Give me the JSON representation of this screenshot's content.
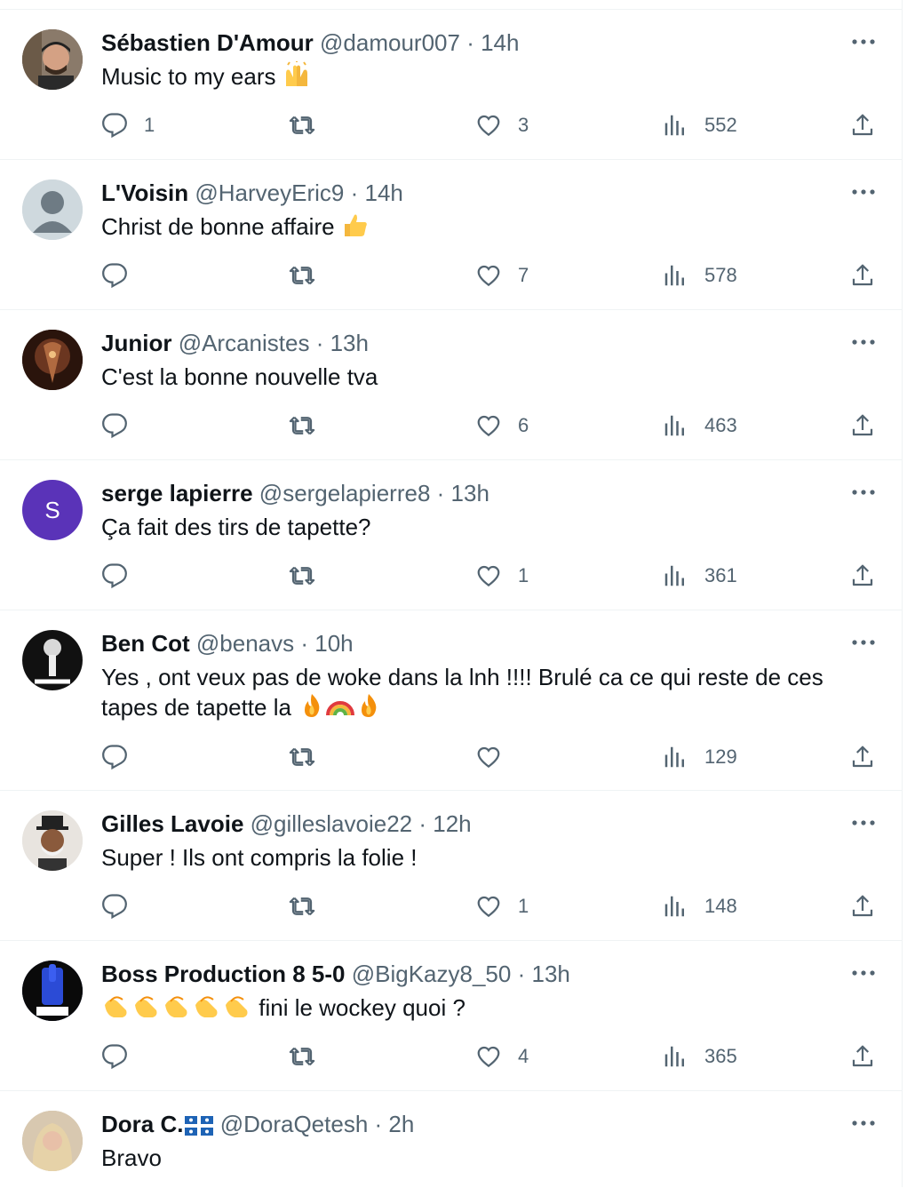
{
  "tweets": [
    {
      "name": "Sébastien D'Amour",
      "handle": "@damour007",
      "time": "14h",
      "text": "Music to my ears",
      "replies": "1",
      "retweets": "",
      "likes": "3",
      "views": "552",
      "avatar_color": "#5b4a3a"
    },
    {
      "name": "L'Voisin",
      "handle": "@HarveyEric9",
      "time": "14h",
      "text": "Christ de bonne affaire",
      "replies": "",
      "retweets": "",
      "likes": "7",
      "views": "578",
      "avatar_color": "#cfd9de"
    },
    {
      "name": "Junior",
      "handle": "@Arcanistes",
      "time": "13h",
      "text": "C'est la bonne nouvelle tva",
      "replies": "",
      "retweets": "",
      "likes": "6",
      "views": "463",
      "avatar_color": "#3a1e14"
    },
    {
      "name": "serge lapierre",
      "handle": "@sergelapierre8",
      "time": "13h",
      "text": "Ça fait des tirs de tapette?",
      "replies": "",
      "retweets": "",
      "likes": "1",
      "views": "361",
      "avatar_color": "#5a33b8",
      "avatar_letter": "S"
    },
    {
      "name": "Ben Cot",
      "handle": "@benavs",
      "time": "10h",
      "text": "Yes , ont veux pas de woke dans la lnh !!!! Brulé ca ce qui reste de ces tapes de tapette la",
      "replies": "",
      "retweets": "",
      "likes": "",
      "views": "129",
      "avatar_color": "#111111"
    },
    {
      "name": "Gilles Lavoie",
      "handle": "@gilleslavoie22",
      "time": "12h",
      "text": "Super ! Ils ont compris la folie !",
      "replies": "",
      "retweets": "",
      "likes": "1",
      "views": "148",
      "avatar_color": "#e8e4df"
    },
    {
      "name": "Boss Production 8 5-0",
      "handle": "@BigKazy8_50",
      "time": "13h",
      "text": "fini le wockey quoi ?",
      "replies": "",
      "retweets": "",
      "likes": "4",
      "views": "365",
      "avatar_color": "#1b2a6b"
    },
    {
      "name": "Dora C.",
      "handle": "@DoraQetesh",
      "time": "2h",
      "text": "Bravo",
      "avatar_color": "#c9b79a"
    }
  ],
  "colors": {
    "text": "#0f1419",
    "muted": "#536471",
    "border": "#eff3f4"
  },
  "icons": [
    "more-icon",
    "reply-icon",
    "retweet-icon",
    "like-icon",
    "views-icon",
    "share-icon"
  ]
}
